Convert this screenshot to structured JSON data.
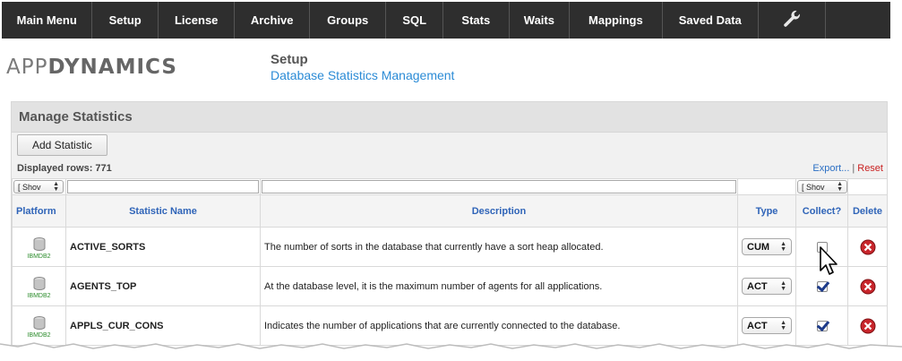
{
  "nav": {
    "items": [
      {
        "label": "Main Menu",
        "w": 102
      },
      {
        "label": "Setup",
        "w": 74
      },
      {
        "label": "License",
        "w": 86
      },
      {
        "label": "Archive",
        "w": 84
      },
      {
        "label": "Groups",
        "w": 86
      },
      {
        "label": "SQL",
        "w": 64
      },
      {
        "label": "Stats",
        "w": 74
      },
      {
        "label": "Waits",
        "w": 68
      },
      {
        "label": "Mappings",
        "w": 104
      },
      {
        "label": "Saved Data",
        "w": 108
      }
    ],
    "wrench_icon": "wrench-icon"
  },
  "logo": {
    "light": "APP",
    "bold": "DYNAMICS"
  },
  "header": {
    "title": "Setup",
    "subtitle": "Database Statistics Management"
  },
  "panel": {
    "title": "Manage Statistics",
    "add_button": "Add Statistic",
    "displayed_rows": "Displayed rows: 771",
    "export_link": "Export...",
    "separator": "|",
    "reset_link": "Reset"
  },
  "filters": {
    "platform_select": "[ Shov",
    "collect_select": "[ Shov"
  },
  "columns": {
    "platform": "Platform",
    "name": "Statistic Name",
    "description": "Description",
    "type": "Type",
    "collect": "Collect?",
    "delete": "Delete"
  },
  "rows": [
    {
      "platform": "IBMDB2",
      "name": "ACTIVE_SORTS",
      "description": "The number of sorts in the database that currently have a sort heap allocated.",
      "type": "CUM",
      "collect": false
    },
    {
      "platform": "IBMDB2",
      "name": "AGENTS_TOP",
      "description": "At the database level, it is the maximum number of agents for all applications.",
      "type": "ACT",
      "collect": true
    },
    {
      "platform": "IBMDB2",
      "name": "APPLS_CUR_CONS",
      "description": "Indicates the number of applications that are currently connected to the database.",
      "type": "ACT",
      "collect": true
    }
  ],
  "colors": {
    "nav_bg": "#2e2e2e",
    "link": "#2b8bd6",
    "header_blue": "#2f64b8",
    "reset": "#c92020"
  }
}
